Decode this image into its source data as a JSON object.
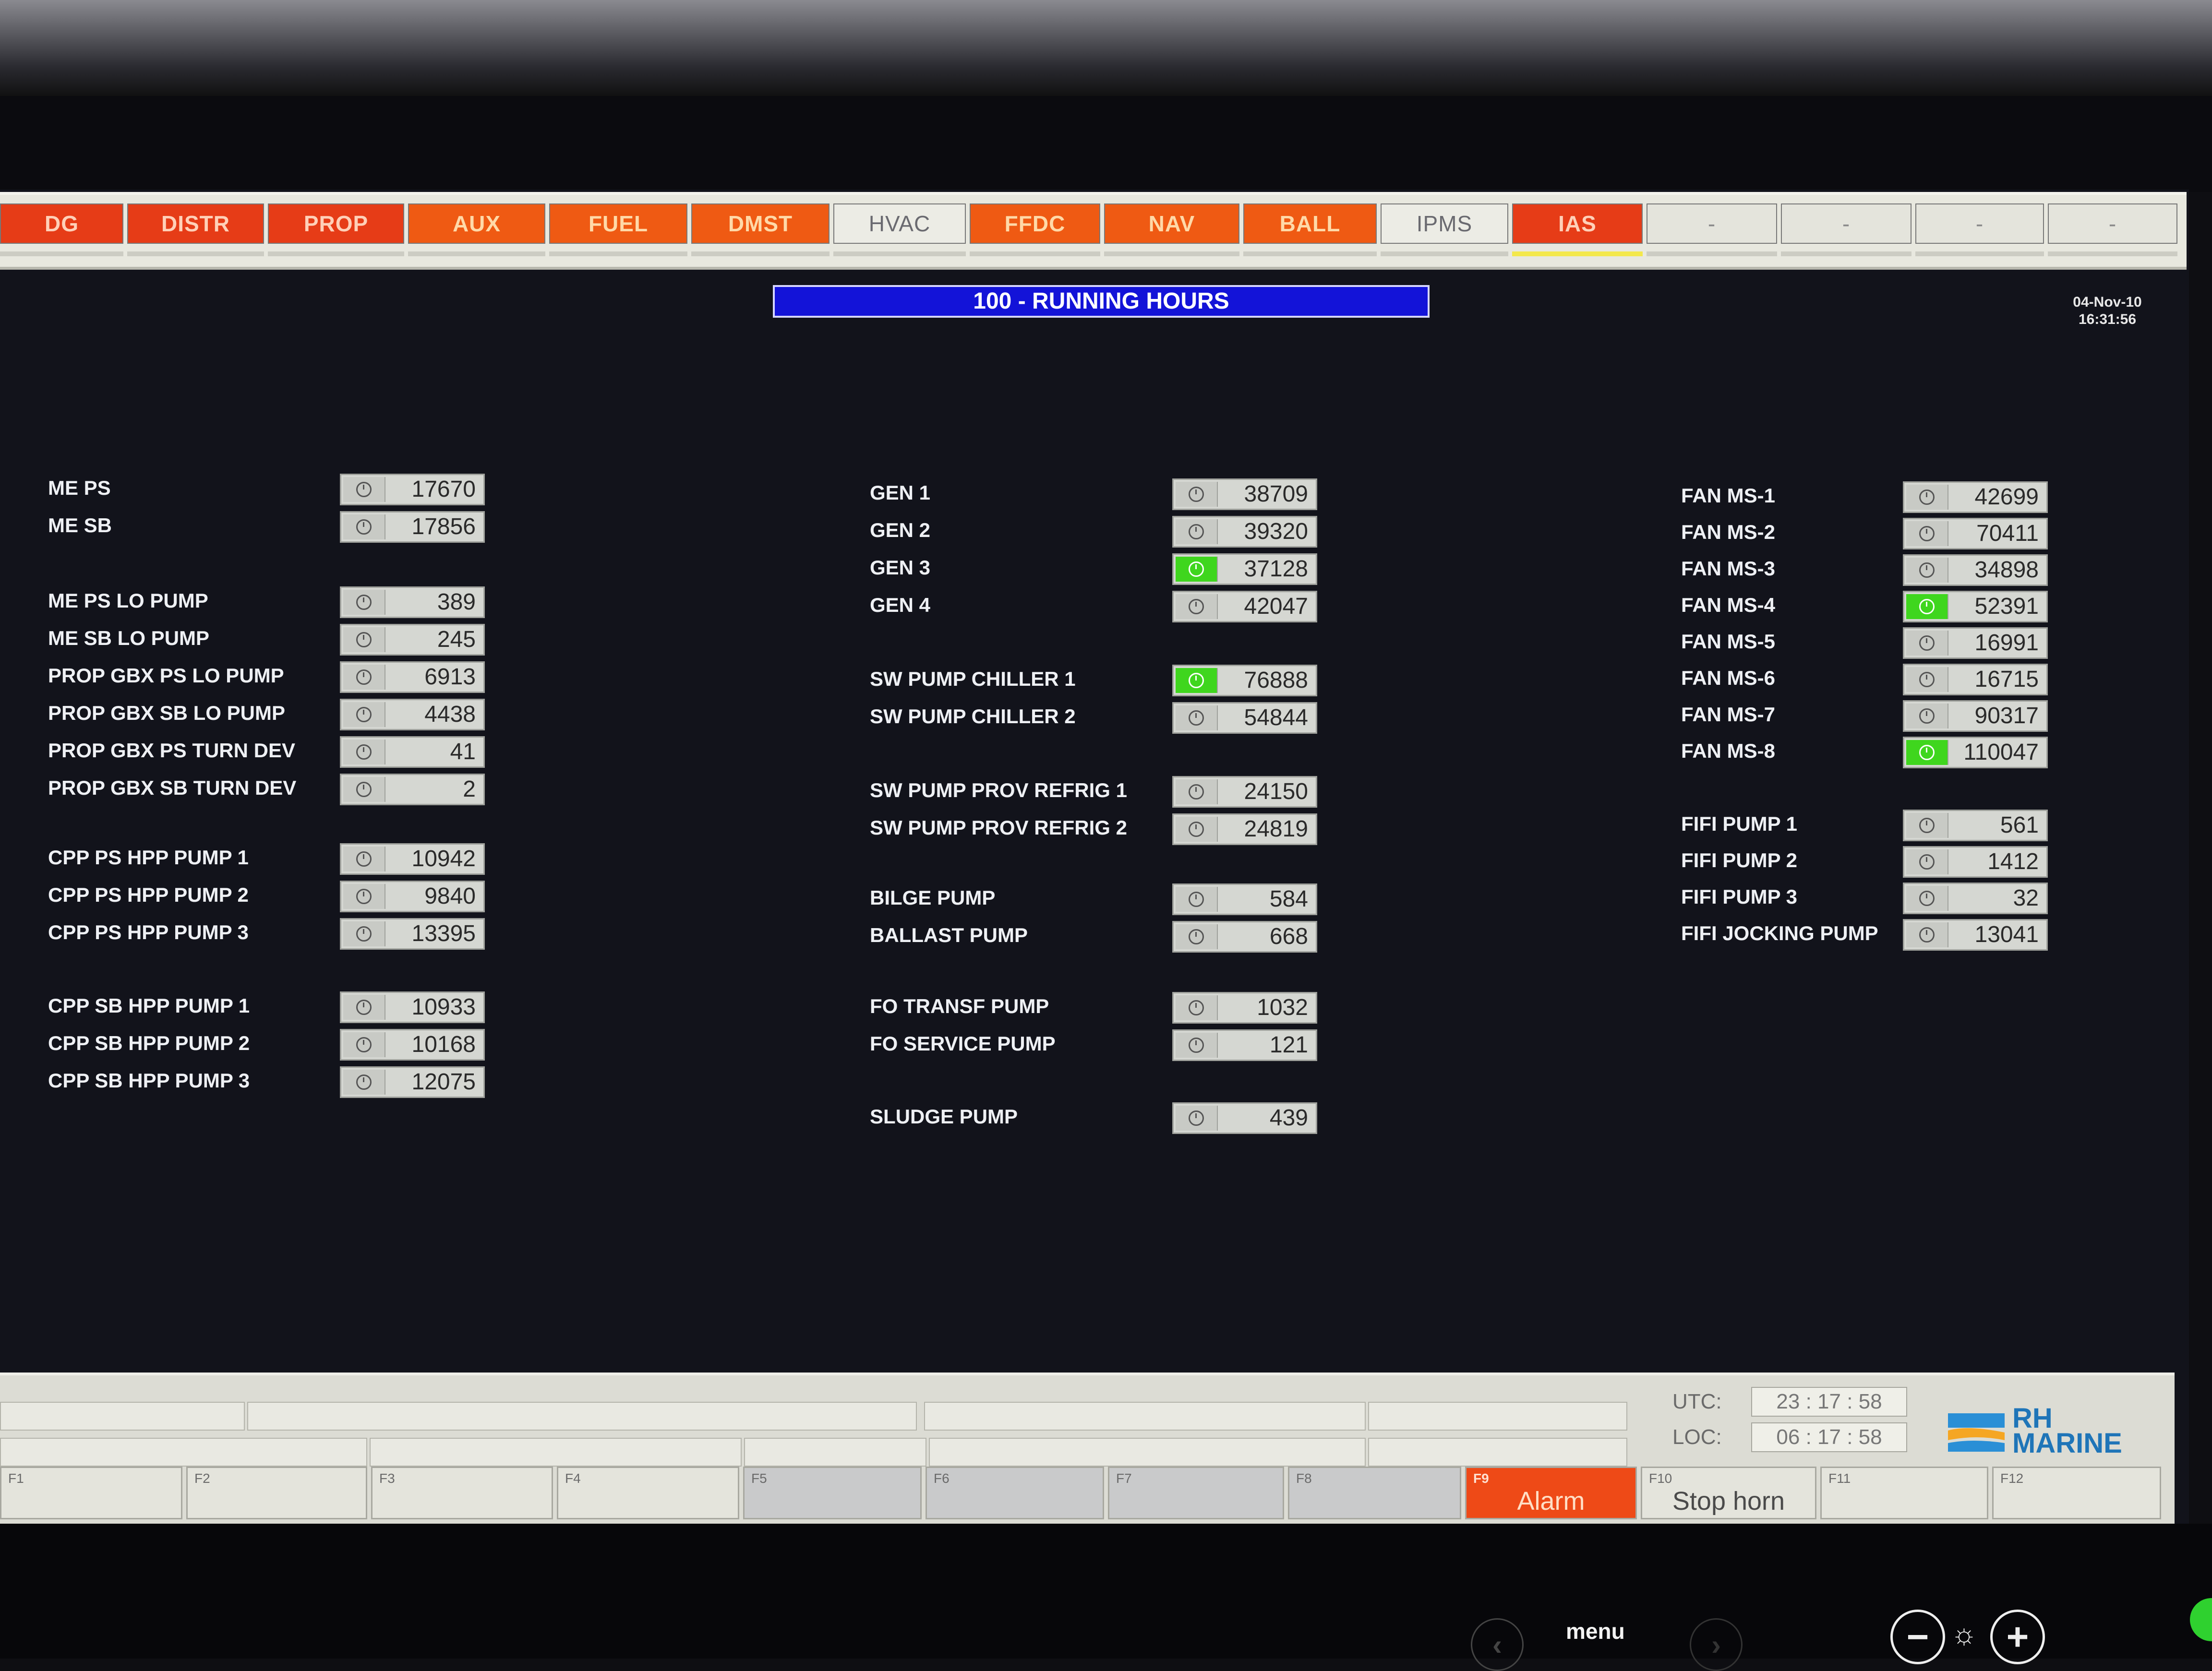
{
  "tabs": [
    {
      "label": "DG",
      "style": "red"
    },
    {
      "label": "DISTR",
      "style": "red"
    },
    {
      "label": "PROP",
      "style": "red"
    },
    {
      "label": "AUX",
      "style": "orange"
    },
    {
      "label": "FUEL",
      "style": "orange"
    },
    {
      "label": "DMST",
      "style": "orange"
    },
    {
      "label": "HVAC",
      "style": "white"
    },
    {
      "label": "FFDC",
      "style": "orange"
    },
    {
      "label": "NAV",
      "style": "orange"
    },
    {
      "label": "BALL",
      "style": "orange"
    },
    {
      "label": "IPMS",
      "style": "white"
    },
    {
      "label": "IAS",
      "style": "red"
    },
    {
      "label": "-",
      "style": "blank"
    },
    {
      "label": "-",
      "style": "blank"
    },
    {
      "label": "-",
      "style": "blank"
    },
    {
      "label": "-",
      "style": "blank"
    }
  ],
  "page_title": "100 - RUNNING HOURS",
  "date": "04-Nov-10",
  "time": "16:31:56",
  "left": [
    {
      "label": "ME PS",
      "value": "17670",
      "active": false
    },
    {
      "label": "ME SB",
      "value": "17856",
      "active": false
    },
    {
      "label": "ME PS LO PUMP",
      "value": "389",
      "active": false
    },
    {
      "label": "ME SB LO PUMP",
      "value": "245",
      "active": false
    },
    {
      "label": "PROP GBX PS LO PUMP",
      "value": "6913",
      "active": false
    },
    {
      "label": "PROP GBX SB LO PUMP",
      "value": "4438",
      "active": false
    },
    {
      "label": "PROP GBX PS TURN DEV",
      "value": "41",
      "active": false
    },
    {
      "label": "PROP GBX SB TURN DEV",
      "value": "2",
      "active": false
    },
    {
      "label": "CPP PS HPP PUMP 1",
      "value": "10942",
      "active": false
    },
    {
      "label": "CPP PS HPP PUMP 2",
      "value": "9840",
      "active": false
    },
    {
      "label": "CPP PS HPP PUMP 3",
      "value": "13395",
      "active": false
    },
    {
      "label": "CPP SB HPP PUMP 1",
      "value": "10933",
      "active": false
    },
    {
      "label": "CPP SB HPP PUMP 2",
      "value": "10168",
      "active": false
    },
    {
      "label": "CPP SB HPP PUMP 3",
      "value": "12075",
      "active": false
    }
  ],
  "middle": [
    {
      "label": "GEN 1",
      "value": "38709",
      "active": false
    },
    {
      "label": "GEN 2",
      "value": "39320",
      "active": false
    },
    {
      "label": "GEN 3",
      "value": "37128",
      "active": true
    },
    {
      "label": "GEN 4",
      "value": "42047",
      "active": false
    },
    {
      "label": "SW PUMP CHILLER 1",
      "value": "76888",
      "active": true
    },
    {
      "label": "SW PUMP CHILLER 2",
      "value": "54844",
      "active": false
    },
    {
      "label": "SW PUMP PROV REFRIG 1",
      "value": "24150",
      "active": false
    },
    {
      "label": "SW PUMP PROV REFRIG 2",
      "value": "24819",
      "active": false
    },
    {
      "label": "BILGE PUMP",
      "value": "584",
      "active": false
    },
    {
      "label": "BALLAST PUMP",
      "value": "668",
      "active": false
    },
    {
      "label": "FO TRANSF PUMP",
      "value": "1032",
      "active": false
    },
    {
      "label": "FO SERVICE PUMP",
      "value": "121",
      "active": false
    },
    {
      "label": "SLUDGE PUMP",
      "value": "439",
      "active": false
    }
  ],
  "right": [
    {
      "label": "FAN MS-1",
      "value": "42699",
      "active": false
    },
    {
      "label": "FAN MS-2",
      "value": "70411",
      "active": false
    },
    {
      "label": "FAN MS-3",
      "value": "34898",
      "active": false
    },
    {
      "label": "FAN MS-4",
      "value": "52391",
      "active": true
    },
    {
      "label": "FAN MS-5",
      "value": "16991",
      "active": false
    },
    {
      "label": "FAN MS-6",
      "value": "16715",
      "active": false
    },
    {
      "label": "FAN MS-7",
      "value": "90317",
      "active": false
    },
    {
      "label": "FAN MS-8",
      "value": "110047",
      "active": true
    },
    {
      "label": "FIFI PUMP 1",
      "value": "561",
      "active": false
    },
    {
      "label": "FIFI PUMP 2",
      "value": "1412",
      "active": false
    },
    {
      "label": "FIFI PUMP 3",
      "value": "32",
      "active": false
    },
    {
      "label": "FIFI JOCKING PUMP",
      "value": "13041",
      "active": false
    }
  ],
  "clock_panel": {
    "utc_label": "UTC:",
    "utc": "23 : 17 : 58",
    "loc_label": "LOC:",
    "loc": "06 : 17 : 58"
  },
  "logo": {
    "line1": "RH",
    "line2": "MARINE"
  },
  "fkeys": [
    {
      "num": "F1",
      "label": "",
      "style": "normal"
    },
    {
      "num": "F2",
      "label": "",
      "style": "normal"
    },
    {
      "num": "F3",
      "label": "",
      "style": "normal"
    },
    {
      "num": "F4",
      "label": "",
      "style": "normal"
    },
    {
      "num": "F5",
      "label": "",
      "style": "grey"
    },
    {
      "num": "F6",
      "label": "",
      "style": "grey"
    },
    {
      "num": "F7",
      "label": "",
      "style": "grey"
    },
    {
      "num": "F8",
      "label": "",
      "style": "grey"
    },
    {
      "num": "F9",
      "label": "Alarm",
      "style": "alarm"
    },
    {
      "num": "F10",
      "label": "Stop horn",
      "style": "normal"
    },
    {
      "num": "F11",
      "label": "",
      "style": "normal"
    },
    {
      "num": "F12",
      "label": "",
      "style": "normal"
    }
  ],
  "hardware": {
    "menu": "menu",
    "back": "‹",
    "fwd": "›",
    "minus": "−",
    "brightness": "☼",
    "plus": "+"
  },
  "colors": {
    "active_green": "#3fd61e",
    "title_blue": "#1313d8",
    "alarm": "#ee4a17"
  }
}
